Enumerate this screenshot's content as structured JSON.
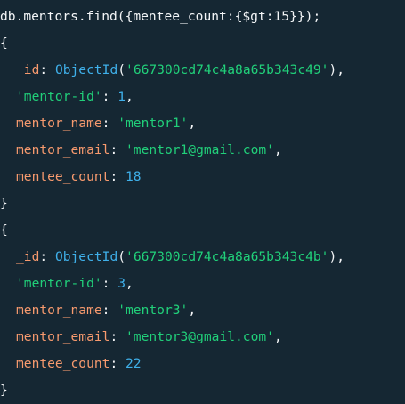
{
  "command": "db.mentors.find({mentee_count:{$gt:15}});",
  "results": [
    {
      "open": "{",
      "id_key": "_id",
      "id_fn": "ObjectId",
      "id_value": "'667300cd74c4a8a65b343c49'",
      "mentor_id_key": "'mentor-id'",
      "mentor_id_value": "1",
      "name_key": "mentor_name",
      "name_value": "'mentor1'",
      "email_key": "mentor_email",
      "email_value": "'mentor1@gmail.com'",
      "count_key": "mentee_count",
      "count_value": "18",
      "close": "}"
    },
    {
      "open": "{",
      "id_key": "_id",
      "id_fn": "ObjectId",
      "id_value": "'667300cd74c4a8a65b343c4b'",
      "mentor_id_key": "'mentor-id'",
      "mentor_id_value": "3",
      "name_key": "mentor_name",
      "name_value": "'mentor3'",
      "email_key": "mentor_email",
      "email_value": "'mentor3@gmail.com'",
      "count_key": "mentee_count",
      "count_value": "22",
      "close": "}"
    }
  ]
}
